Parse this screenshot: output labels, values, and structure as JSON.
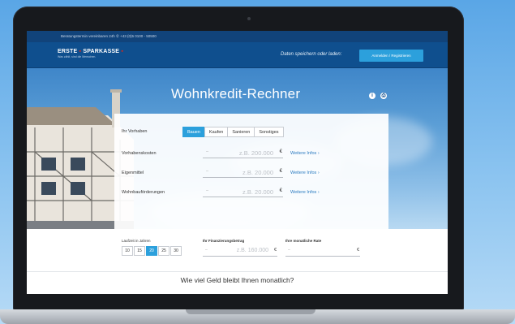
{
  "topbar": {
    "text": "Beratungstermin vereinbaren 24h ✆ +43 (0)5 0100 - 50500"
  },
  "header": {
    "logo_part1": "ERSTE",
    "logo_part2": "SPARKASSE",
    "logo_tagline": "Was zählt, sind die Menschen.",
    "save_label": "Daten speichern oder laden:",
    "login_button": "Anmelden / Registrieren"
  },
  "hero": {
    "title": "Wohnkredit-Rechner",
    "info_icon": "i",
    "print_icon": "⎙"
  },
  "form": {
    "project_label": "Ihr Vorhaben",
    "tabs": [
      {
        "label": "Bauen"
      },
      {
        "label": "Kaufen"
      },
      {
        "label": "Sanieren"
      },
      {
        "label": "Sonstiges"
      }
    ],
    "rows": [
      {
        "label": "Vorhabenskosten",
        "prefix": "–",
        "placeholder": "z.B. 200.000",
        "currency": "€",
        "link": "Weitere Infos ›"
      },
      {
        "label": "Eigenmittel",
        "prefix": "–",
        "placeholder": "z.B. 20.000",
        "currency": "€",
        "link": "Weitere Infos ›"
      },
      {
        "label": "Wohnbauförderungen",
        "prefix": "–",
        "placeholder": "z.B. 20.000",
        "currency": "€",
        "link": "Weitere Infos ›"
      }
    ]
  },
  "bottom": {
    "term_label": "Laufzeit in Jahren",
    "years": [
      "10",
      "15",
      "20",
      "25",
      "30"
    ],
    "financing_label": "Ihr Finanzierungsbetrag",
    "financing_prefix": "–",
    "financing_placeholder": "z.B. 160.000",
    "financing_currency": "€",
    "rate_label": "Ihre monatliche Rate",
    "rate_prefix": "–",
    "rate_currency": "€",
    "question": "Wie viel Geld bleibt Ihnen monatlich?"
  },
  "colors": {
    "accent": "#2ca0dc",
    "brand": "#0f4f8e",
    "logo_red": "#e42313"
  }
}
